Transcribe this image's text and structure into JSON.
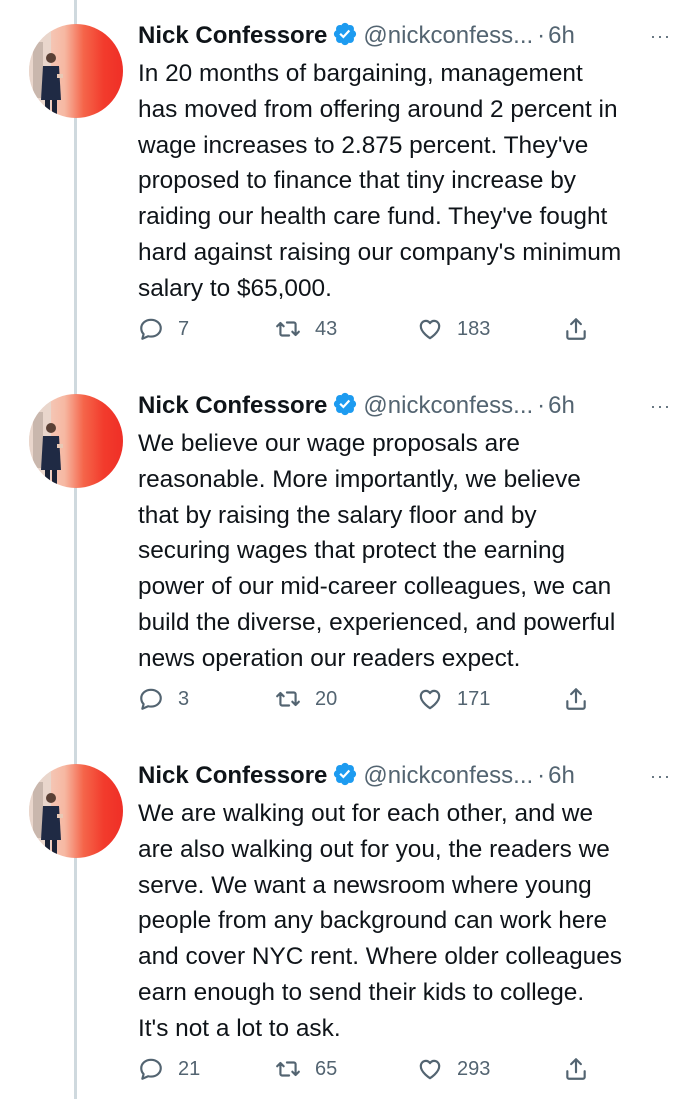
{
  "tweets": [
    {
      "author": {
        "name": "Nick Confessore",
        "handle": "@nickconfess...",
        "verified": true
      },
      "time": "6h",
      "text": "In 20 months of bargaining, management\nhas moved from offering around 2 percent in\nwage increases to 2.875 percent. They've\nproposed to finance that tiny increase by\nraiding our health care fund. They've fought\nhard against raising our company's minimum\nsalary to $65,000.",
      "replies": "7",
      "retweets": "43",
      "likes": "183"
    },
    {
      "author": {
        "name": "Nick Confessore",
        "handle": "@nickconfess...",
        "verified": true
      },
      "time": "6h",
      "text": "We believe our wage proposals are\nreasonable. More importantly, we believe\nthat by raising the salary floor and by\nsecuring wages that protect the earning\npower of our mid-career colleagues, we can\nbuild the diverse, experienced, and powerful\nnews operation our readers expect.",
      "replies": "3",
      "retweets": "20",
      "likes": "171"
    },
    {
      "author": {
        "name": "Nick Confessore",
        "handle": "@nickconfess...",
        "verified": true
      },
      "time": "6h",
      "text": "We are walking out for each other, and we\nare also walking out for you, the readers we\nserve. We want a newsroom where young\npeople from any background can work here\nand cover NYC rent. Where older colleagues\nearn enough to send their kids to college.\nIt's not a lot to ask.",
      "replies": "21",
      "retweets": "65",
      "likes": "293"
    }
  ],
  "ui": {
    "separator": "·",
    "more_glyph": "···"
  },
  "icons": {
    "reply": "speech-bubble-icon",
    "retweet": "retweet-arrows-icon",
    "like": "heart-outline-icon",
    "share": "share-upload-icon",
    "verified": "verified-badge-icon",
    "more": "ellipsis-icon"
  },
  "colors": {
    "text": "#0f1419",
    "secondary": "#536471",
    "verified": "#1d9bf0",
    "thread_line": "#cfd9de",
    "avatar_accent": "#ef2f27"
  }
}
